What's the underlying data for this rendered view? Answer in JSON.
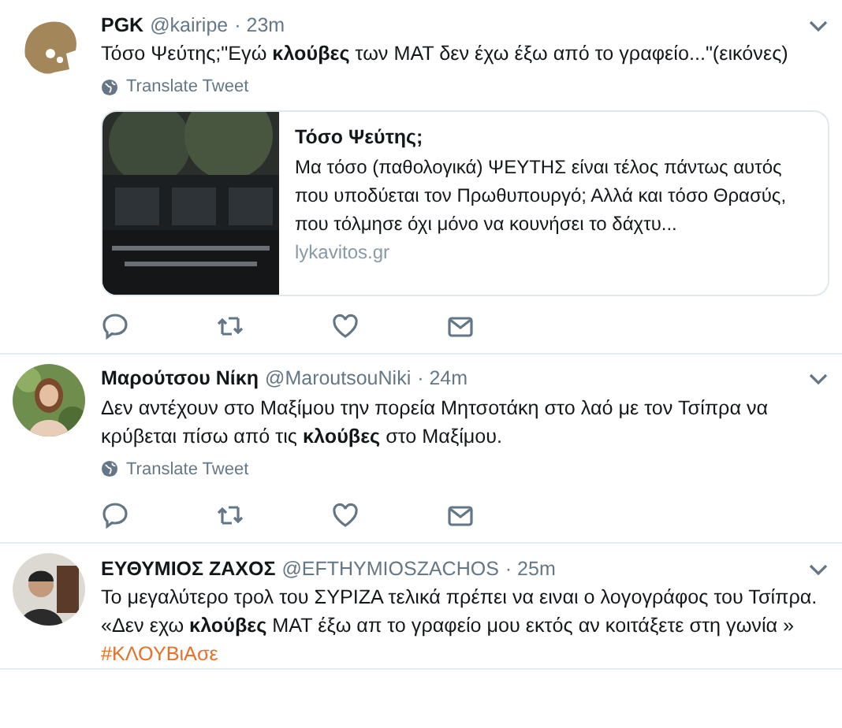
{
  "tweets": [
    {
      "name": "PGK",
      "handle": "@kairipe",
      "time": "· 23m",
      "paragraphs": [
        "Τόσο Ψεύτης;\"Εγώ **κλούβες** των ΜΑΤ δεν έχω έξω από το γραφείο...\"(εικόνες)"
      ],
      "translate": "Translate Tweet",
      "card": {
        "kind": "picture",
        "title": "Τόσο Ψεύτης;",
        "description": "Μα τόσο (παθολογικά) ΨΕΥΤΗΣ είναι τέλος πάντως αυτός που υποδύεται τον Πρωθυπουργό; Αλλά και τόσο Θρασύς, που τόλμησε όχι μόνο να κουνήσει το δάχτυ...",
        "domain": "lykavitos.gr"
      }
    },
    {
      "name": "Μαρούτσου Νίκη",
      "handle": "@MaroutsouNiki",
      "time": "· 24m",
      "paragraphs": [
        "Δεν αντέχουν στο Μαξίμου την πορεία Μητσοτάκη στο λαό με τον Τσίπρα να κρύβεται πίσω από τις **κλούβες** στο Μαξίμου."
      ],
      "translate": "Translate Tweet"
    },
    {
      "name": "ΕΥΘΥΜΙΟΣ ΖΑΧΟΣ",
      "handle": "@EFTHYMIOSZACHOS",
      "time": "· 25m",
      "paragraphs": [
        "Το μεγαλύτερο τρολ του ΣΥΡΙΖΑ τελικά πρέπει να ειναι ο λογογράφος του Τσίπρα.",
        "«Δεν εχω **κλούβες** ΜΑΤ έξω απ το γραφείο μου εκτός αν κοιτάξετε στη γωνία »"
      ],
      "hashtag": "#ΚΛΟΥΒιΑσε"
    }
  ]
}
